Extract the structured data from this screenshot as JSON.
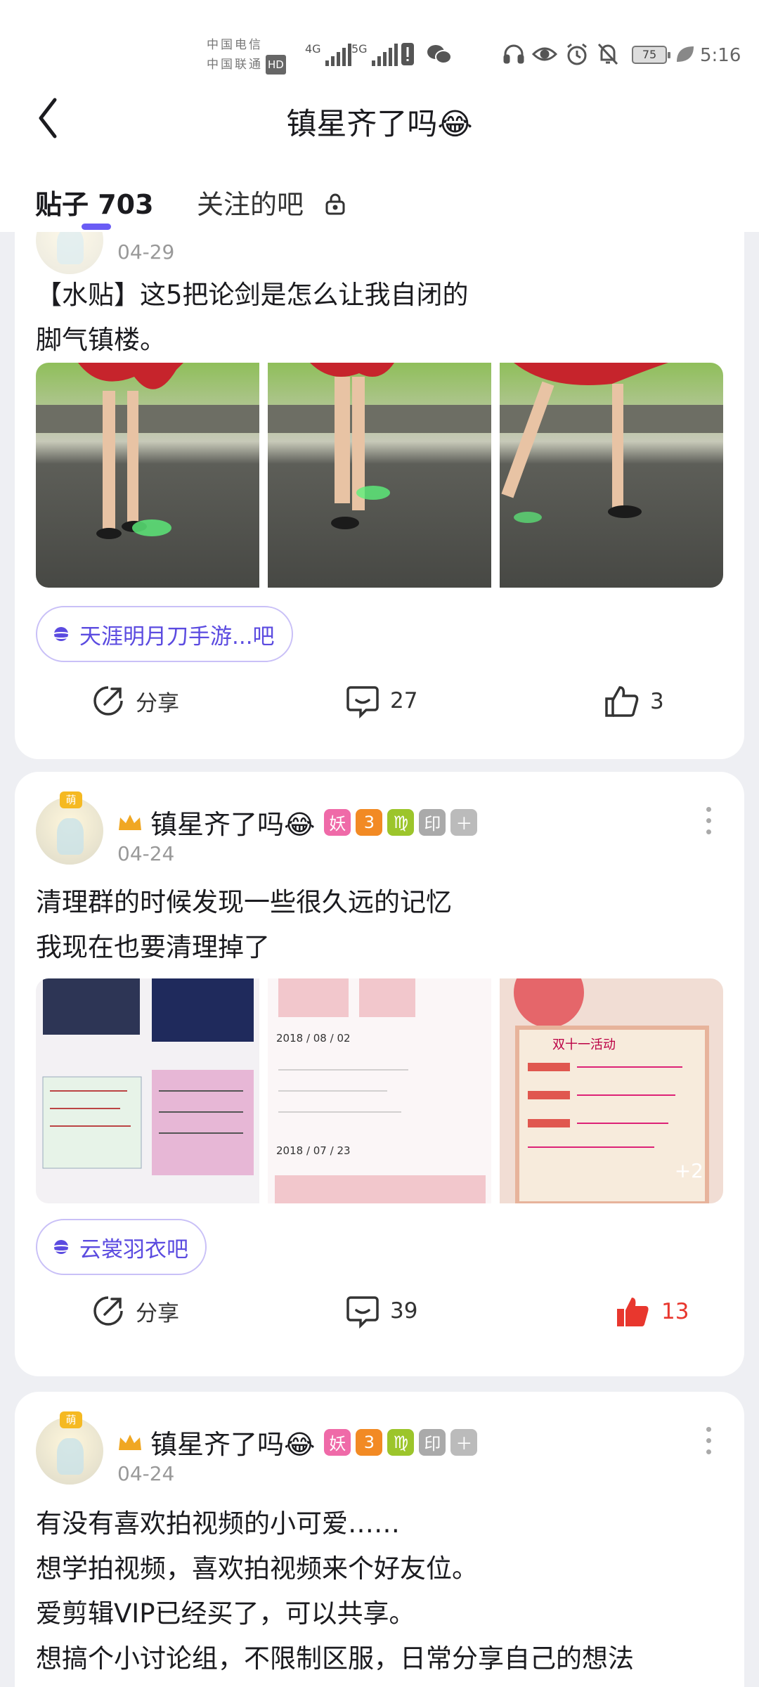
{
  "status": {
    "carrier1": "中国电信",
    "carrier2": "中国联通",
    "hd": "HD",
    "net1": "4G",
    "net2": "5G",
    "battery": "75",
    "time": "5:16"
  },
  "nav": {
    "title": "镇星齐了吗😂"
  },
  "tabs": [
    {
      "label": "贴子 703"
    },
    {
      "label": "关注的吧"
    }
  ],
  "posts": [
    {
      "date": "04-29",
      "lines": [
        "【水贴】这5把论剑是怎么让我自闭的",
        "脚气镇楼。"
      ],
      "tag": "天涯明月刀手游...吧",
      "share": "分享",
      "comments": "27",
      "likes": "3"
    },
    {
      "crown": "萌",
      "username": "镇星齐了吗😂",
      "badges": [
        "妖",
        "3",
        "♍",
        "印",
        "＋"
      ],
      "date": "04-24",
      "lines": [
        "清理群的时候发现一些很久远的记忆",
        "我现在也要清理掉了"
      ],
      "img_texts": [
        "2018 / 08 / 02",
        "2018 / 07 / 23",
        "双十一活动"
      ],
      "more_images": "+2",
      "tag": "云裳羽衣吧",
      "share": "分享",
      "comments": "39",
      "likes": "13"
    },
    {
      "crown": "萌",
      "username": "镇星齐了吗😂",
      "badges": [
        "妖",
        "3",
        "♍",
        "印",
        "＋"
      ],
      "date": "04-24",
      "lines": [
        "有没有喜欢拍视频的小可爱……",
        "想学拍视频，喜欢拍视频来个好友位。",
        "爱剪辑VIP已经买了，可以共享。",
        "想搞个小讨论组，不限制区服，日常分享自己的想法"
      ]
    }
  ],
  "colors": {
    "accent": "#6a5cf5",
    "like_active": "#e8372e"
  }
}
